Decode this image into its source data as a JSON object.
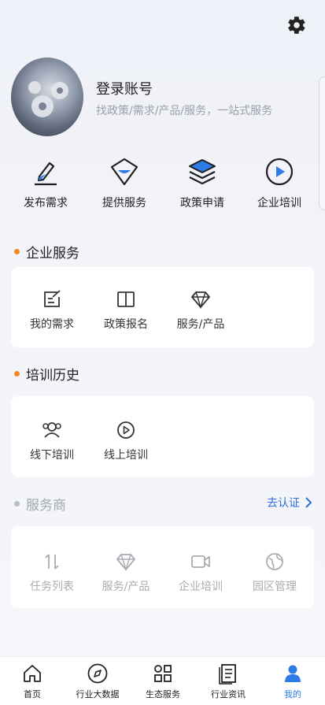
{
  "profile": {
    "title": "登录账号",
    "subtitle": "找政策/需求/产品/服务，一站式服务"
  },
  "quick_actions": [
    {
      "label": "发布需求",
      "icon": "pen-icon"
    },
    {
      "label": "提供服务",
      "icon": "service-shield-icon"
    },
    {
      "label": "政策申请",
      "icon": "layers-icon"
    },
    {
      "label": "企业培训",
      "icon": "play-circle-icon"
    }
  ],
  "sections": {
    "enterprise": {
      "title": "企业服务",
      "items": [
        {
          "label": "我的需求",
          "icon": "edit-note-icon"
        },
        {
          "label": "政策报名",
          "icon": "book-icon"
        },
        {
          "label": "服务/产品",
          "icon": "diamond-icon"
        }
      ]
    },
    "training": {
      "title": "培训历史",
      "items": [
        {
          "label": "线下培训",
          "icon": "users-icon"
        },
        {
          "label": "线上培训",
          "icon": "play-circle-icon"
        }
      ]
    },
    "provider": {
      "title": "服务商",
      "action": "去认证",
      "items": [
        {
          "label": "任务列表",
          "icon": "sort-arrows-icon"
        },
        {
          "label": "服务/产品",
          "icon": "diamond-icon"
        },
        {
          "label": "企业培训",
          "icon": "video-camera-icon"
        },
        {
          "label": "园区管理",
          "icon": "globe-leaf-icon"
        }
      ]
    }
  },
  "tabbar": [
    {
      "label": "首页",
      "icon": "home-icon"
    },
    {
      "label": "行业大数据",
      "icon": "compass-icon"
    },
    {
      "label": "生态服务",
      "icon": "grid-icon"
    },
    {
      "label": "行业资讯",
      "icon": "document-icon"
    },
    {
      "label": "我的",
      "icon": "user-icon",
      "active": true
    }
  ],
  "colors": {
    "accent": "#2f7be5",
    "bullet": "#f08a24",
    "link": "#2f6fd6"
  }
}
